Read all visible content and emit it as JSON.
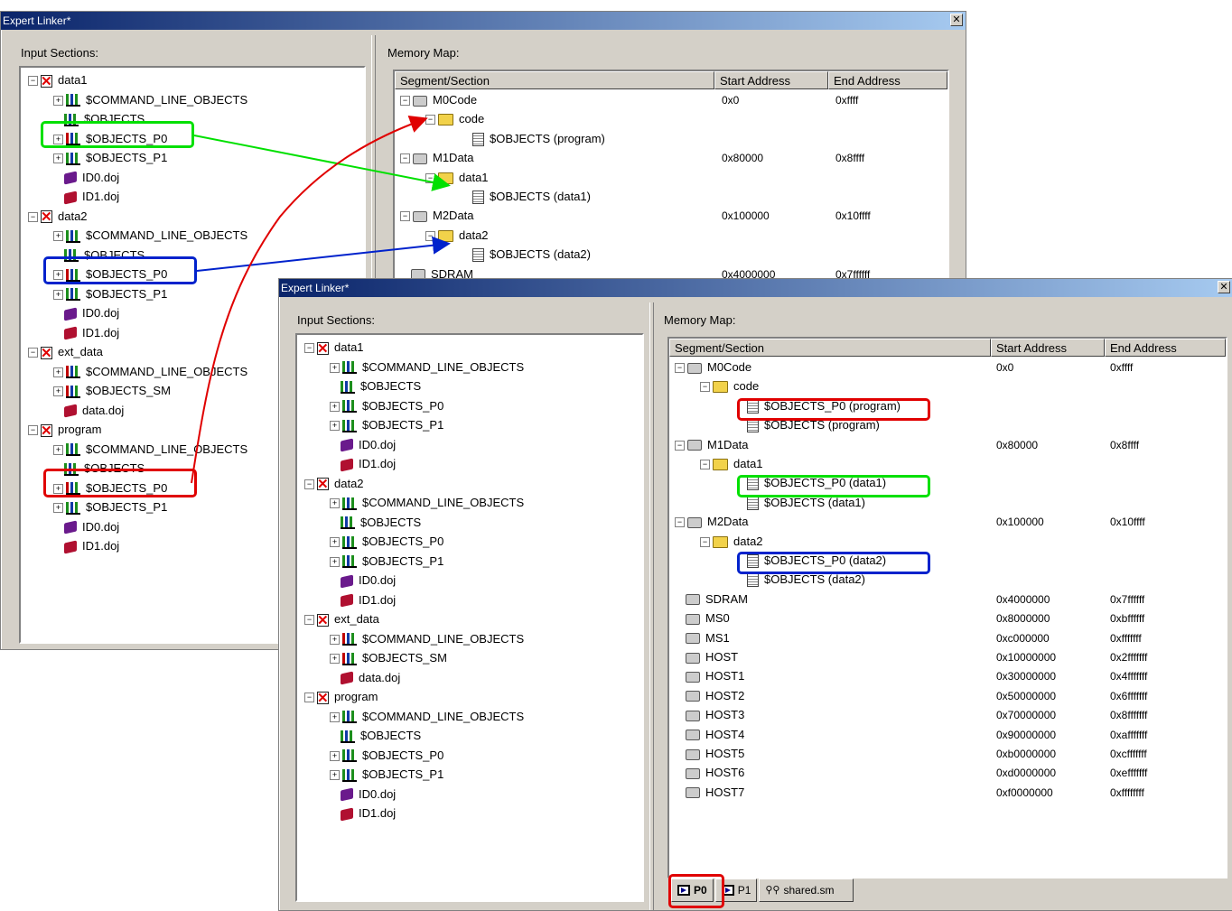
{
  "back_window": {
    "title": "Expert Linker*",
    "close_label": "✕",
    "input_sections_label": "Input Sections:",
    "memory_map_label": "Memory Map:",
    "input_tree": [
      {
        "type": "group",
        "label": "data1",
        "toggle": "−"
      },
      {
        "type": "obj",
        "label": "$COMMAND_LINE_OBJECTS",
        "toggle": "+"
      },
      {
        "type": "obj",
        "label": "$OBJECTS",
        "toggle": ""
      },
      {
        "type": "obj",
        "label": "$OBJECTS_P0",
        "toggle": "+",
        "red": true
      },
      {
        "type": "obj",
        "label": "$OBJECTS_P1",
        "toggle": "+"
      },
      {
        "type": "doj",
        "label": "ID0.doj"
      },
      {
        "type": "doj",
        "label": "ID1.doj",
        "red": true
      },
      {
        "type": "group",
        "label": "data2",
        "toggle": "−"
      },
      {
        "type": "obj",
        "label": "$COMMAND_LINE_OBJECTS",
        "toggle": "+"
      },
      {
        "type": "obj",
        "label": "$OBJECTS",
        "toggle": ""
      },
      {
        "type": "obj",
        "label": "$OBJECTS_P0",
        "toggle": "+",
        "red": true
      },
      {
        "type": "obj",
        "label": "$OBJECTS_P1",
        "toggle": "+"
      },
      {
        "type": "doj",
        "label": "ID0.doj"
      },
      {
        "type": "doj",
        "label": "ID1.doj",
        "red": true
      },
      {
        "type": "group",
        "label": "ext_data",
        "toggle": "−"
      },
      {
        "type": "obj",
        "label": "$COMMAND_LINE_OBJECTS",
        "toggle": "+",
        "red": true
      },
      {
        "type": "obj",
        "label": "$OBJECTS_SM",
        "toggle": "+",
        "red": true
      },
      {
        "type": "doj",
        "label": "data.doj",
        "red": true
      },
      {
        "type": "group",
        "label": "program",
        "toggle": "−"
      },
      {
        "type": "obj",
        "label": "$COMMAND_LINE_OBJECTS",
        "toggle": "+"
      },
      {
        "type": "obj",
        "label": "$OBJECTS",
        "toggle": ""
      },
      {
        "type": "obj",
        "label": "$OBJECTS_P0",
        "toggle": "+",
        "red": true
      },
      {
        "type": "obj",
        "label": "$OBJECTS_P1",
        "toggle": "+"
      },
      {
        "type": "doj",
        "label": "ID0.doj"
      },
      {
        "type": "doj",
        "label": "ID1.doj",
        "red": true
      }
    ],
    "columns": [
      "Segment/Section",
      "Start Address",
      "End Address"
    ],
    "memory_rows": [
      {
        "kind": "mem",
        "label": "M0Code",
        "start": "0x0",
        "end": "0xffff",
        "toggle": "−"
      },
      {
        "kind": "folder",
        "label": "code",
        "toggle": "−"
      },
      {
        "kind": "page",
        "label": "$OBJECTS (program)"
      },
      {
        "kind": "mem",
        "label": "M1Data",
        "start": "0x80000",
        "end": "0x8ffff",
        "toggle": "−"
      },
      {
        "kind": "folder",
        "label": "data1",
        "toggle": "−"
      },
      {
        "kind": "page",
        "label": "$OBJECTS (data1)"
      },
      {
        "kind": "mem",
        "label": "M2Data",
        "start": "0x100000",
        "end": "0x10ffff",
        "toggle": "−"
      },
      {
        "kind": "folder",
        "label": "data2",
        "toggle": "−"
      },
      {
        "kind": "page",
        "label": "$OBJECTS (data2)"
      },
      {
        "kind": "mem",
        "label": "SDRAM",
        "start": "0x4000000",
        "end": "0x7ffffff"
      }
    ]
  },
  "front_window": {
    "title": "Expert Linker*",
    "close_label": "✕",
    "input_sections_label": "Input Sections:",
    "memory_map_label": "Memory Map:",
    "input_tree": [
      {
        "type": "group",
        "label": "data1",
        "toggle": "−"
      },
      {
        "type": "obj",
        "label": "$COMMAND_LINE_OBJECTS",
        "toggle": "+"
      },
      {
        "type": "obj",
        "label": "$OBJECTS",
        "toggle": ""
      },
      {
        "type": "obj",
        "label": "$OBJECTS_P0",
        "toggle": "+"
      },
      {
        "type": "obj",
        "label": "$OBJECTS_P1",
        "toggle": "+"
      },
      {
        "type": "doj",
        "label": "ID0.doj"
      },
      {
        "type": "doj",
        "label": "ID1.doj",
        "red": true
      },
      {
        "type": "group",
        "label": "data2",
        "toggle": "−"
      },
      {
        "type": "obj",
        "label": "$COMMAND_LINE_OBJECTS",
        "toggle": "+"
      },
      {
        "type": "obj",
        "label": "$OBJECTS",
        "toggle": ""
      },
      {
        "type": "obj",
        "label": "$OBJECTS_P0",
        "toggle": "+"
      },
      {
        "type": "obj",
        "label": "$OBJECTS_P1",
        "toggle": "+"
      },
      {
        "type": "doj",
        "label": "ID0.doj"
      },
      {
        "type": "doj",
        "label": "ID1.doj",
        "red": true
      },
      {
        "type": "group",
        "label": "ext_data",
        "toggle": "−"
      },
      {
        "type": "obj",
        "label": "$COMMAND_LINE_OBJECTS",
        "toggle": "+",
        "red": true
      },
      {
        "type": "obj",
        "label": "$OBJECTS_SM",
        "toggle": "+",
        "red": true
      },
      {
        "type": "doj",
        "label": "data.doj",
        "red": true
      },
      {
        "type": "group",
        "label": "program",
        "toggle": "−"
      },
      {
        "type": "obj",
        "label": "$COMMAND_LINE_OBJECTS",
        "toggle": "+"
      },
      {
        "type": "obj",
        "label": "$OBJECTS",
        "toggle": ""
      },
      {
        "type": "obj",
        "label": "$OBJECTS_P0",
        "toggle": "+"
      },
      {
        "type": "obj",
        "label": "$OBJECTS_P1",
        "toggle": "+"
      },
      {
        "type": "doj",
        "label": "ID0.doj"
      },
      {
        "type": "doj",
        "label": "ID1.doj",
        "red": true
      }
    ],
    "columns": [
      "Segment/Section",
      "Start Address",
      "End Address"
    ],
    "memory_rows": [
      {
        "kind": "mem",
        "label": "M0Code",
        "start": "0x0",
        "end": "0xffff",
        "toggle": "−"
      },
      {
        "kind": "folder",
        "label": "code",
        "toggle": "−"
      },
      {
        "kind": "page",
        "label": "$OBJECTS_P0 (program)"
      },
      {
        "kind": "page",
        "label": "$OBJECTS (program)"
      },
      {
        "kind": "mem",
        "label": "M1Data",
        "start": "0x80000",
        "end": "0x8ffff",
        "toggle": "−"
      },
      {
        "kind": "folder",
        "label": "data1",
        "toggle": "−"
      },
      {
        "kind": "page",
        "label": "$OBJECTS_P0 (data1)"
      },
      {
        "kind": "page",
        "label": "$OBJECTS (data1)"
      },
      {
        "kind": "mem",
        "label": "M2Data",
        "start": "0x100000",
        "end": "0x10ffff",
        "toggle": "−"
      },
      {
        "kind": "folder",
        "label": "data2",
        "toggle": "−"
      },
      {
        "kind": "page",
        "label": "$OBJECTS_P0 (data2)"
      },
      {
        "kind": "page",
        "label": "$OBJECTS (data2)"
      },
      {
        "kind": "mem",
        "label": "SDRAM",
        "start": "0x4000000",
        "end": "0x7ffffff"
      },
      {
        "kind": "mem",
        "label": "MS0",
        "start": "0x8000000",
        "end": "0xbffffff"
      },
      {
        "kind": "mem",
        "label": "MS1",
        "start": "0xc000000",
        "end": "0xfffffff"
      },
      {
        "kind": "mem",
        "label": "HOST",
        "start": "0x10000000",
        "end": "0x2fffffff"
      },
      {
        "kind": "mem",
        "label": "HOST1",
        "start": "0x30000000",
        "end": "0x4fffffff"
      },
      {
        "kind": "mem",
        "label": "HOST2",
        "start": "0x50000000",
        "end": "0x6fffffff"
      },
      {
        "kind": "mem",
        "label": "HOST3",
        "start": "0x70000000",
        "end": "0x8fffffff"
      },
      {
        "kind": "mem",
        "label": "HOST4",
        "start": "0x90000000",
        "end": "0xafffffff"
      },
      {
        "kind": "mem",
        "label": "HOST5",
        "start": "0xb0000000",
        "end": "0xcfffffff"
      },
      {
        "kind": "mem",
        "label": "HOST6",
        "start": "0xd0000000",
        "end": "0xefffffff"
      },
      {
        "kind": "mem",
        "label": "HOST7",
        "start": "0xf0000000",
        "end": "0xffffffff"
      }
    ],
    "tabs": [
      "P0",
      "P1",
      "shared.sm"
    ]
  },
  "colors": {
    "green": "#00e000",
    "blue": "#0022cc",
    "red": "#e00000"
  }
}
